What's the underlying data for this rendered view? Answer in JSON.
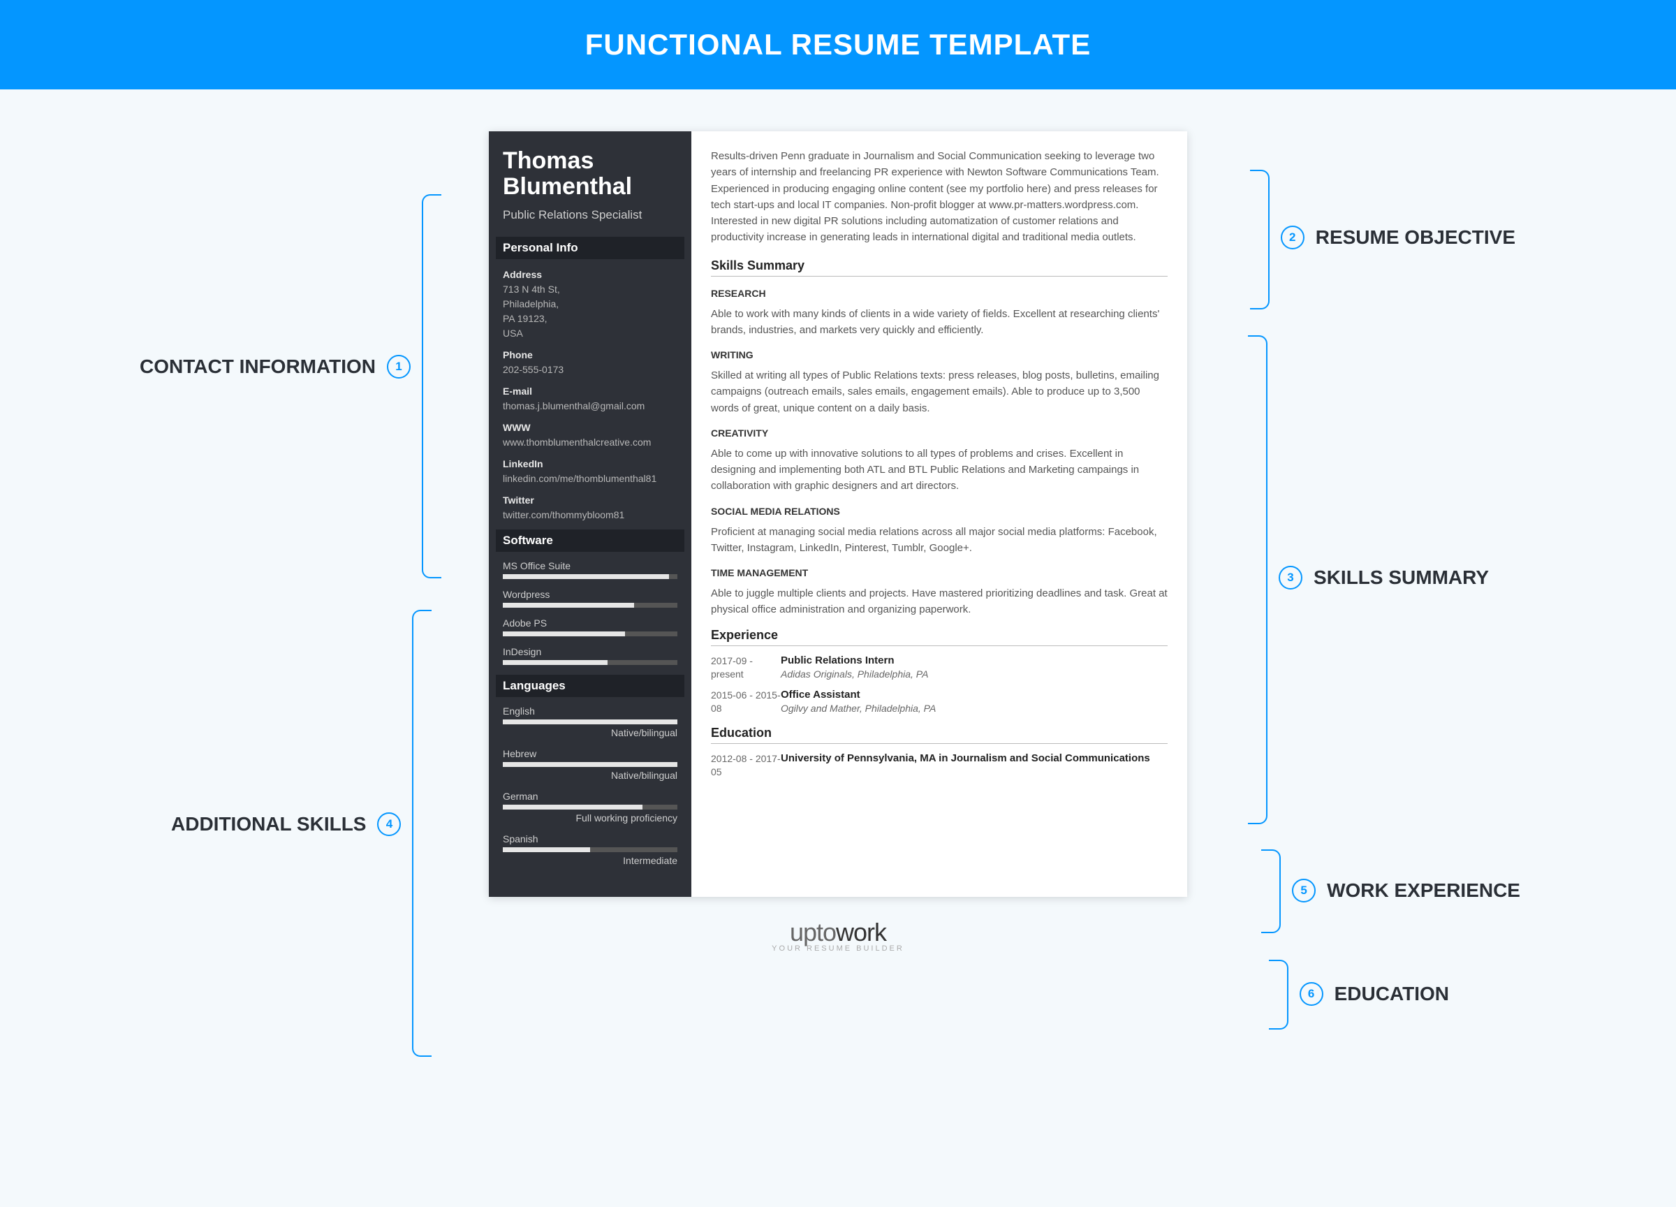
{
  "banner": "FUNCTIONAL RESUME TEMPLATE",
  "callouts": {
    "contact": "CONTACT INFORMATION",
    "additional": "ADDITIONAL SKILLS",
    "objective": "RESUME OBJECTIVE",
    "skills": "SKILLS SUMMARY",
    "work": "WORK EXPERIENCE",
    "education": "EDUCATION"
  },
  "name": "Thomas Blumenthal",
  "title": "Public Relations Specialist",
  "personal_info_hdr": "Personal Info",
  "info": {
    "address_lbl": "Address",
    "address": "713 N 4th St,\nPhiladelphia,\nPA 19123,\nUSA",
    "phone_lbl": "Phone",
    "phone": "202-555-0173",
    "email_lbl": "E-mail",
    "email": "thomas.j.blumenthal@gmail.com",
    "www_lbl": "WWW",
    "www": "www.thomblumenthalcreative.com",
    "linkedin_lbl": "LinkedIn",
    "linkedin": "linkedin.com/me/thomblumenthal81",
    "twitter_lbl": "Twitter",
    "twitter": "twitter.com/thommybloom81"
  },
  "software_hdr": "Software",
  "software": [
    {
      "name": "MS Office Suite",
      "pct": 95
    },
    {
      "name": "Wordpress",
      "pct": 75
    },
    {
      "name": "Adobe PS",
      "pct": 70
    },
    {
      "name": "InDesign",
      "pct": 60
    }
  ],
  "languages_hdr": "Languages",
  "languages": [
    {
      "name": "English",
      "pct": 100,
      "level": "Native/bilingual"
    },
    {
      "name": "Hebrew",
      "pct": 100,
      "level": "Native/bilingual"
    },
    {
      "name": "German",
      "pct": 80,
      "level": "Full working proficiency"
    },
    {
      "name": "Spanish",
      "pct": 50,
      "level": "Intermediate"
    }
  ],
  "objective": "Results-driven Penn graduate in Journalism and Social Communication seeking to leverage two years of internship and freelancing PR experience with Newton Software Communications Team. Experienced in producing engaging online content (see my portfolio here) and press releases for tech start-ups and local IT companies. Non-profit blogger at www.pr-matters.wordpress.com. Interested in new digital PR solutions including automatization of customer relations and productivity increase in generating leads in international digital and traditional media outlets.",
  "skills_hdr": "Skills Summary",
  "skills": [
    {
      "title": "RESEARCH",
      "text": "Able to work with many kinds of clients in a wide variety of fields. Excellent at researching clients' brands, industries, and markets very quickly and efficiently."
    },
    {
      "title": "WRITING",
      "text": "Skilled at writing all types of Public Relations texts: press releases, blog posts, bulletins, emailing campaigns (outreach emails, sales emails, engagement emails). Able to produce up to 3,500 words of great, unique content on a daily basis."
    },
    {
      "title": "CREATIVITY",
      "text": "Able to come up with innovative solutions to all types of problems and crises. Excellent in designing and implementing both ATL and BTL Public Relations and Marketing campaings in collaboration with graphic designers and art directors."
    },
    {
      "title": "SOCIAL MEDIA RELATIONS",
      "text": "Proficient at managing social media relations across all major social media platforms: Facebook, Twitter, Instagram, LinkedIn, Pinterest, Tumblr, Google+."
    },
    {
      "title": "TIME MANAGEMENT",
      "text": "Able to juggle multiple clients and projects. Have mastered prioritizing deadlines and task. Great at physical office administration and organizing paperwork."
    }
  ],
  "exp_hdr": "Experience",
  "experience": [
    {
      "date": "2017-09 - present",
      "role": "Public Relations Intern",
      "org": "Adidas Originals, Philadelphia, PA"
    },
    {
      "date": "2015-06 - 2015-08",
      "role": "Office Assistant",
      "org": "Ogilvy and Mather, Philadelphia, PA"
    }
  ],
  "edu_hdr": "Education",
  "education": [
    {
      "date": "2012-08 - 2017-05",
      "role": "University of Pennsylvania, MA in Journalism and Social Communications",
      "org": ""
    }
  ],
  "footer_brand_1": "upto",
  "footer_brand_2": "work",
  "footer_tag": "YOUR RESUME BUILDER"
}
